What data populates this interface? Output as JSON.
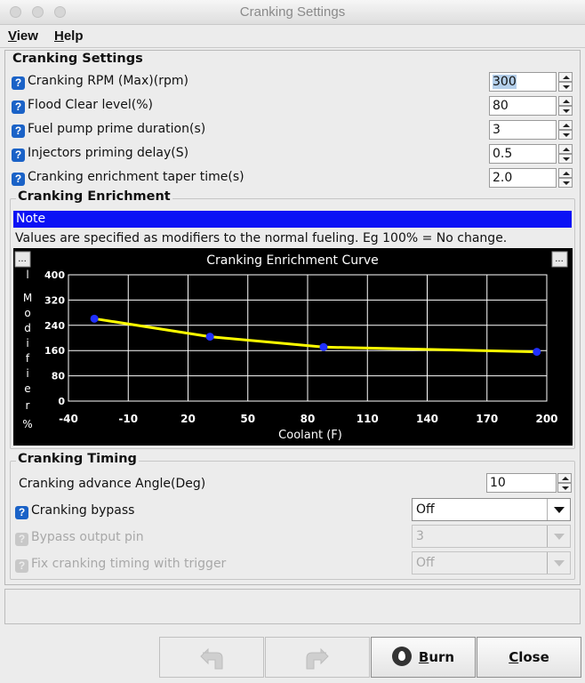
{
  "window": {
    "title": "Cranking Settings"
  },
  "menubar": {
    "items": [
      {
        "underline": "V",
        "rest": "iew"
      },
      {
        "underline": "H",
        "rest": "elp"
      }
    ]
  },
  "cranking_settings": {
    "title": "Cranking Settings",
    "rows": [
      {
        "label": "Cranking RPM (Max)(rpm)",
        "value": "300"
      },
      {
        "label": "Flood Clear level(%)",
        "value": "80"
      },
      {
        "label": "Fuel pump prime duration(s)",
        "value": "3"
      },
      {
        "label": "Injectors priming delay(S)",
        "value": "0.5"
      },
      {
        "label": "Cranking enrichment taper time(s)",
        "value": "2.0"
      }
    ]
  },
  "cranking_enrichment": {
    "title": "Cranking Enrichment",
    "note_label": "Note",
    "note_text": "Values are specified as modifiers to the normal fueling. Eg 100% = No change.",
    "menu_button": "...",
    "y_axis_letters": [
      "l",
      "M",
      "o",
      "d",
      "i",
      "f",
      "i",
      "e",
      "r",
      "%"
    ]
  },
  "chart_data": {
    "type": "line",
    "title": "Cranking Enrichment Curve",
    "xlabel": "Coolant (F)",
    "ylabel": "l Modifier %",
    "x_ticks": [
      "-40",
      "-10",
      "20",
      "50",
      "80",
      "110",
      "140",
      "170",
      "200"
    ],
    "y_ticks": [
      "400",
      "320",
      "240",
      "160",
      "80",
      "0"
    ],
    "xlim": [
      -40,
      200
    ],
    "ylim": [
      0,
      400
    ],
    "grid": true,
    "series": [
      {
        "x": [
          -27,
          31,
          88,
          195
        ],
        "y": [
          261,
          204,
          171,
          156
        ]
      }
    ],
    "colors": {
      "background": "#000000",
      "grid": "#ffffff",
      "line": "#ffff00",
      "point": "#2030ff"
    }
  },
  "cranking_timing": {
    "title": "Cranking Timing",
    "advance_label": "Cranking advance Angle(Deg)",
    "advance_value": "10",
    "bypass_label": "Cranking bypass",
    "bypass_value": "Off",
    "bypass_pin_label": "Bypass output pin",
    "bypass_pin_value": "3",
    "fix_timing_label": "Fix cranking timing with trigger",
    "fix_timing_value": "Off"
  },
  "buttons": {
    "burn_underline": "B",
    "burn_rest": "urn",
    "close_underline": "C",
    "close_rest": "lose"
  },
  "colors": {
    "note_bar": "#0b12f5",
    "help_icon": "#1a62c7"
  }
}
